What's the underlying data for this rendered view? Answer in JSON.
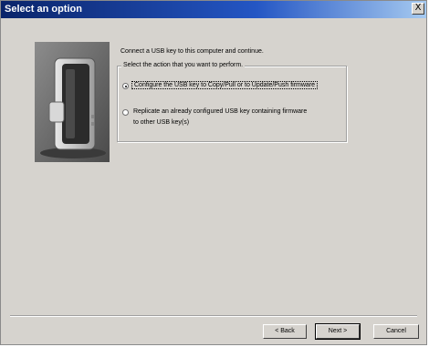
{
  "window": {
    "title": "Select an option",
    "close_glyph": "X"
  },
  "intro": "Connect a USB key to this computer and continue.",
  "group": {
    "legend": "Select the action that you want to perform.",
    "options": [
      {
        "label": "Configure the USB key to Copy/Pull or to Update/Push firmware",
        "selected": true
      },
      {
        "label_line1": "Replicate an already configured USB key containing firmware",
        "label_line2": "to other USB key(s)",
        "selected": false
      }
    ]
  },
  "buttons": {
    "back": "< Back",
    "next": "Next >",
    "cancel": "Cancel"
  },
  "colors": {
    "dialog_bg": "#d6d3ce",
    "title_bar": "#0a246a"
  },
  "icons": {
    "device": "thin-client-device-image"
  }
}
